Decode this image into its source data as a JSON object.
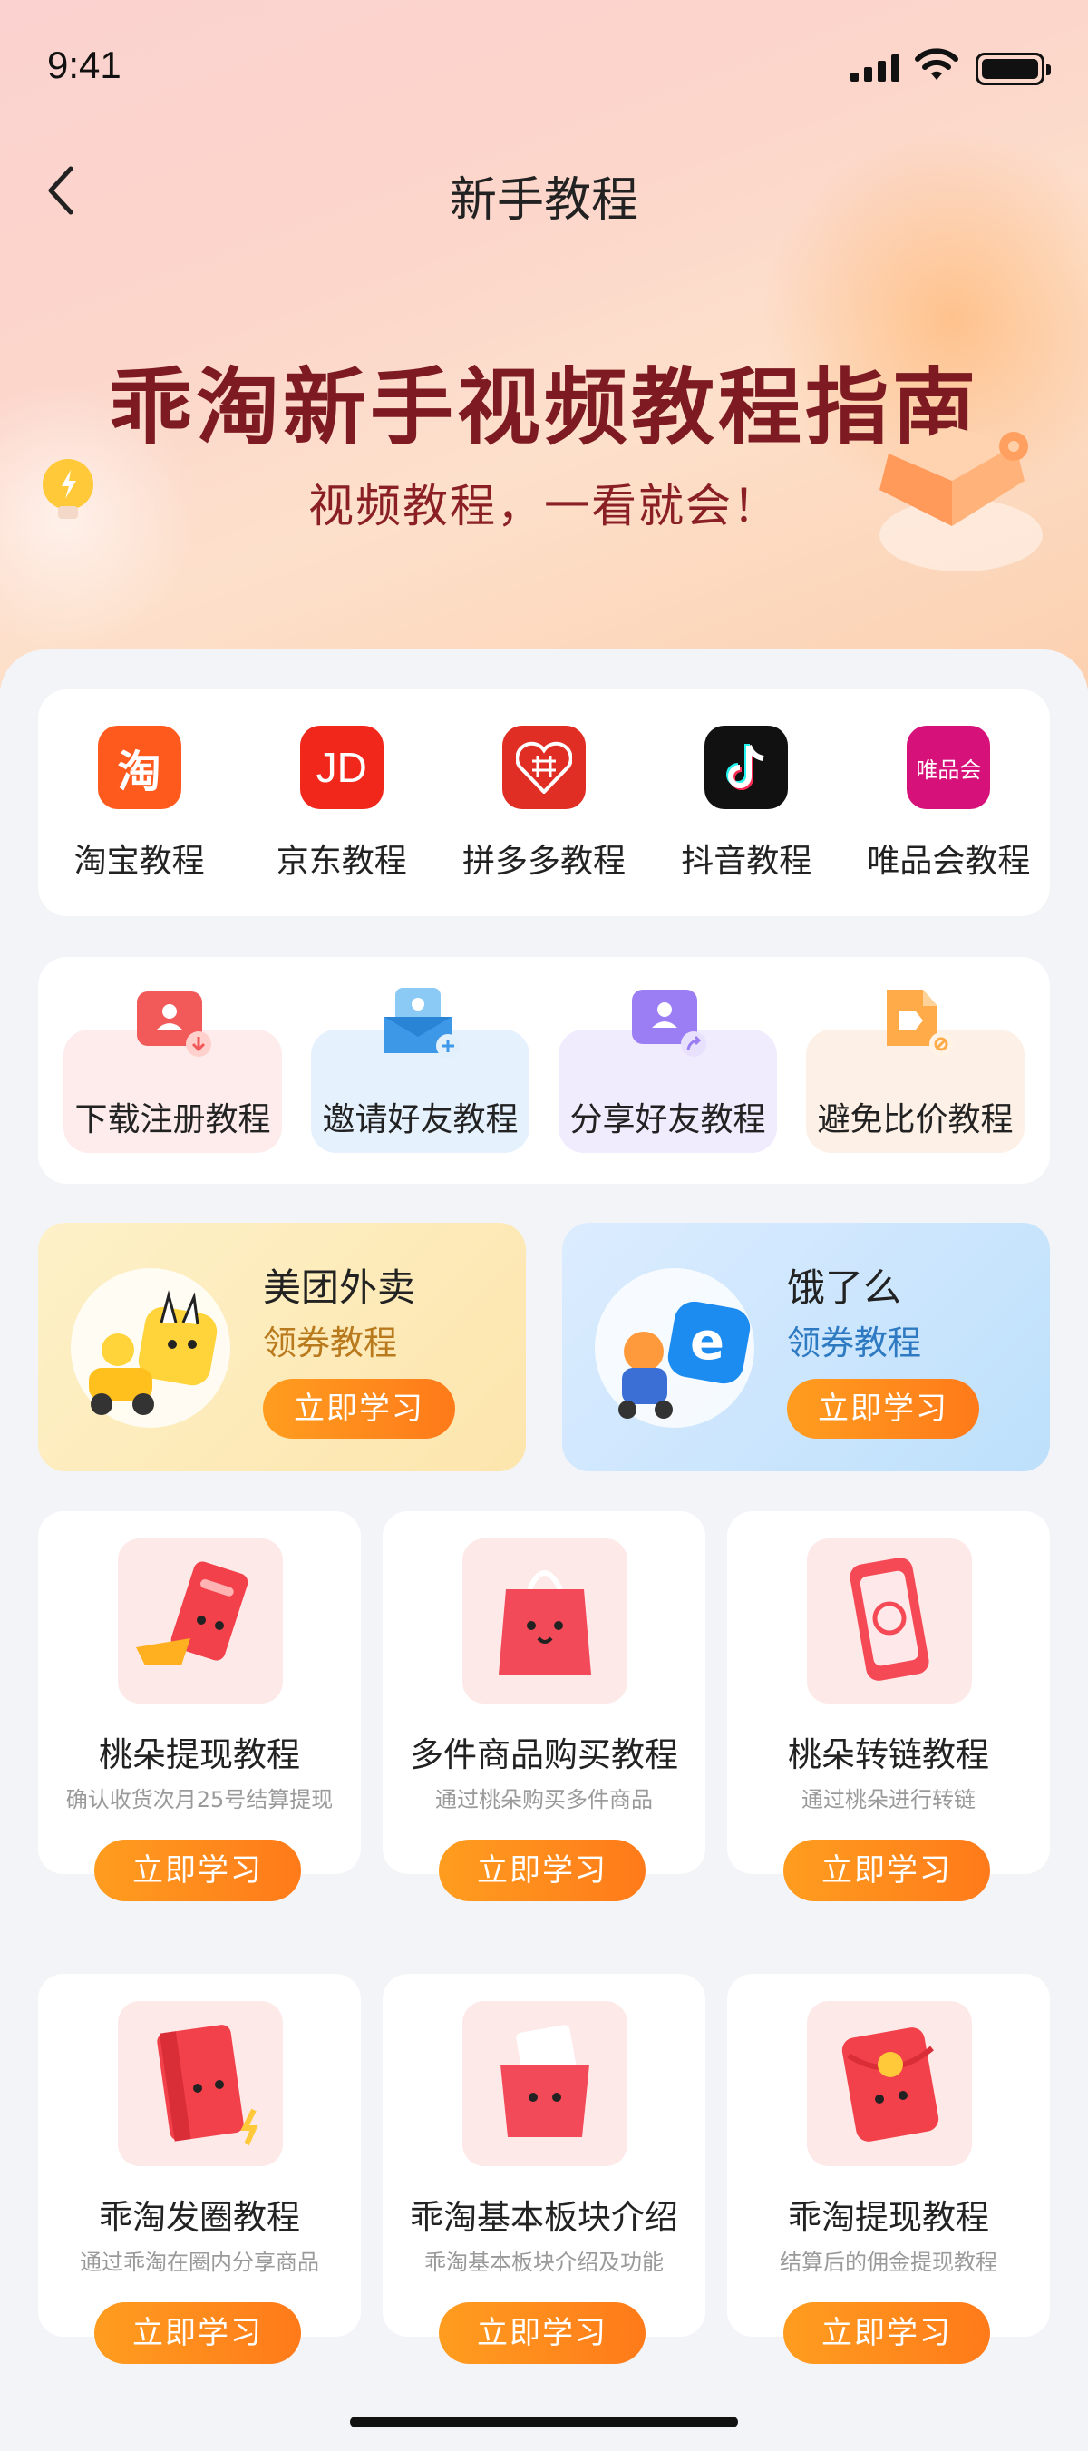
{
  "status_bar": {
    "time": "9:41"
  },
  "nav": {
    "title": "新手教程"
  },
  "hero": {
    "title": "乖淘新手视频教程指南",
    "subtitle": "视频教程，一看就会！"
  },
  "platforms": [
    {
      "label": "淘宝教程",
      "logo_text": "淘",
      "color": "#ff5a1e"
    },
    {
      "label": "京东教程",
      "logo_text": "JD",
      "color": "#f2271c"
    },
    {
      "label": "拼多多教程",
      "logo_text": "",
      "color": "#e02e24"
    },
    {
      "label": "抖音教程",
      "logo_text": "",
      "color": "#111111"
    },
    {
      "label": "唯品会教程",
      "logo_text": "唯品会",
      "color": "#d6127a"
    }
  ],
  "guides": [
    {
      "label": "下载注册教程",
      "icon": "download-register-icon"
    },
    {
      "label": "邀请好友教程",
      "icon": "invite-friend-icon"
    },
    {
      "label": "分享好友教程",
      "icon": "share-friend-icon"
    },
    {
      "label": "避免比价教程",
      "icon": "avoid-price-compare-icon"
    }
  ],
  "food": [
    {
      "name": "美团外卖",
      "tag": "领券教程",
      "button": "立即学习"
    },
    {
      "name": "饿了么",
      "tag": "领券教程",
      "button": "立即学习"
    }
  ],
  "tutorials": [
    {
      "title": "桃朵提现教程",
      "desc": "确认收货次月25号结算提现",
      "button": "立即学习"
    },
    {
      "title": "多件商品购买教程",
      "desc": "通过桃朵购买多件商品",
      "button": "立即学习"
    },
    {
      "title": "桃朵转链教程",
      "desc": "通过桃朵进行转链",
      "button": "立即学习"
    },
    {
      "title": "乖淘发圈教程",
      "desc": "通过乖淘在圈内分享商品",
      "button": "立即学习"
    },
    {
      "title": "乖淘基本板块介绍",
      "desc": "乖淘基本板块介绍及功能",
      "button": "立即学习"
    },
    {
      "title": "乖淘提现教程",
      "desc": "结算后的佣金提现教程",
      "button": "立即学习"
    }
  ]
}
